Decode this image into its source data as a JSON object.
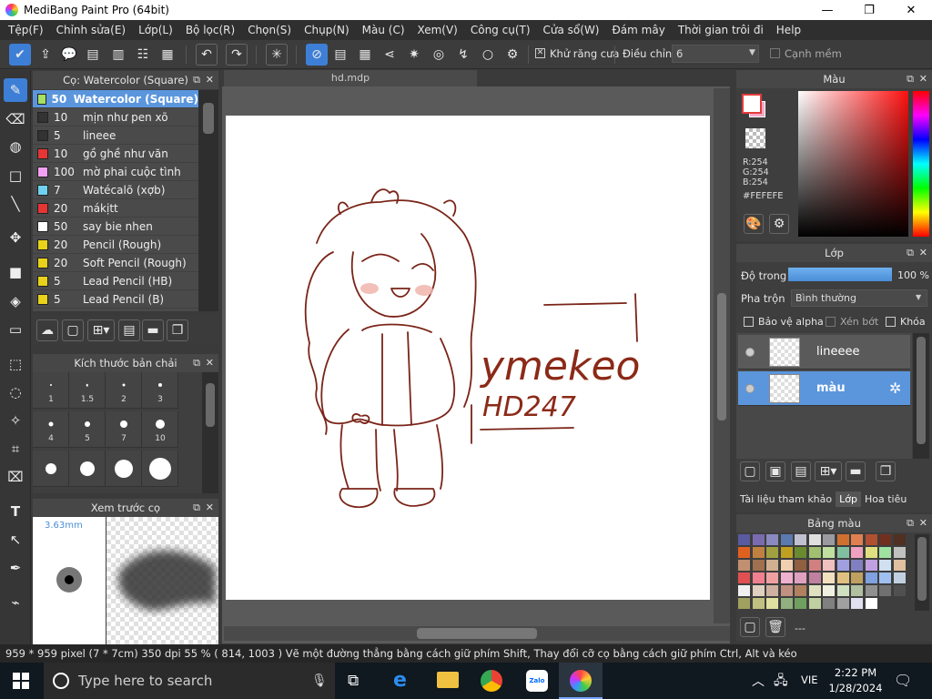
{
  "window": {
    "title": "MediBang Paint Pro (64bit)",
    "min": "—",
    "max": "❐",
    "close": "✕"
  },
  "menu": [
    "Tệp(F)",
    "Chỉnh sửa(E)",
    "Lớp(L)",
    "Bộ lọc(R)",
    "Chọn(S)",
    "Chụp(N)",
    "Màu (C)",
    "Xem(V)",
    "Công cụ(T)",
    "Cửa sổ(W)",
    "Đám mây",
    "Thời gian trôi đi",
    "Help"
  ],
  "toolbar": {
    "antialias_label": "Khử răng cưa",
    "adjust_label": "Điều chỉnh",
    "adjust_value": "6",
    "soft_edge_label": "Cạnh mềm"
  },
  "brush_panel": {
    "title": "Cọ: Watercolor (Square)",
    "items": [
      {
        "size": "50",
        "name": "Watercolor (Square)",
        "color": "#a6e063"
      },
      {
        "size": "10",
        "name": "mịn như pen xõ",
        "color": "#333333"
      },
      {
        "size": "5",
        "name": "lineee",
        "color": "#333333"
      },
      {
        "size": "10",
        "name": "gồ ghề như văn",
        "color": "#e53535"
      },
      {
        "size": "100",
        "name": "mờ phai cuộc tình",
        "color": "#f2a0f2"
      },
      {
        "size": "7",
        "name": "Watécalõ (xợb)",
        "color": "#6fd0f0"
      },
      {
        "size": "20",
        "name": "mákịtt",
        "color": "#e53535"
      },
      {
        "size": "50",
        "name": "say bie nhen",
        "color": "#ffffff"
      },
      {
        "size": "20",
        "name": "Pencil (Rough)",
        "color": "#e8d21a"
      },
      {
        "size": "20",
        "name": "Soft Pencil (Rough)",
        "color": "#e8d21a"
      },
      {
        "size": "5",
        "name": "Lead Pencil (HB)",
        "color": "#e8d21a"
      },
      {
        "size": "5",
        "name": "Lead Pencil (B)",
        "color": "#e8d21a"
      },
      {
        "size": "5",
        "name": "Lead Pencil (6B)",
        "color": "#e8d21a"
      }
    ]
  },
  "size_panel": {
    "title": "Kích thước bản chải",
    "sizes": [
      "1",
      "1.5",
      "2",
      "3",
      "4",
      "5",
      "7",
      "10",
      "",
      "",
      "",
      ""
    ]
  },
  "preview_panel": {
    "title": "Xem trước cọ",
    "size": "3.63mm"
  },
  "canvas": {
    "tab": "hd.mdp",
    "text1": "ymekeo",
    "text2": "HD247"
  },
  "color_panel": {
    "title": "Màu",
    "r": "R:254",
    "g": "G:254",
    "b": "B:254",
    "hex": "#FEFEFE",
    "fg": "#fefefe",
    "accent": "#e23b3b"
  },
  "layer_panel": {
    "title": "Lớp",
    "opacity_label": "Độ trong",
    "opacity_value": "100 %",
    "opacity": 1.0,
    "blend_label": "Pha trộn",
    "blend_value": "Bình thường",
    "protect_alpha": "Bảo vệ alpha",
    "clipping": "Xén bớt",
    "lock": "Khóa",
    "layers": [
      {
        "name": "lineeee"
      },
      {
        "name": "màu"
      }
    ],
    "tabs": [
      "Tài liệu tham khảo",
      "Lớp",
      "Hoa tiêu"
    ]
  },
  "palette_panel": {
    "title": "Bảng màu",
    "footer": "---"
  },
  "status": {
    "text": "959 * 959 pixel   (7 * 7cm)   350 dpi   55 %   ( 814, 1003 )   Vẽ một đường thẳng bằng cách giữ phím Shift, Thay đổi cỡ cọ bằng cách giữ phím Ctrl, Alt và kéo"
  },
  "taskbar": {
    "search_placeholder": "Type here to search",
    "lang": "VIE",
    "time": "2:22 PM",
    "date": "1/28/2024"
  }
}
